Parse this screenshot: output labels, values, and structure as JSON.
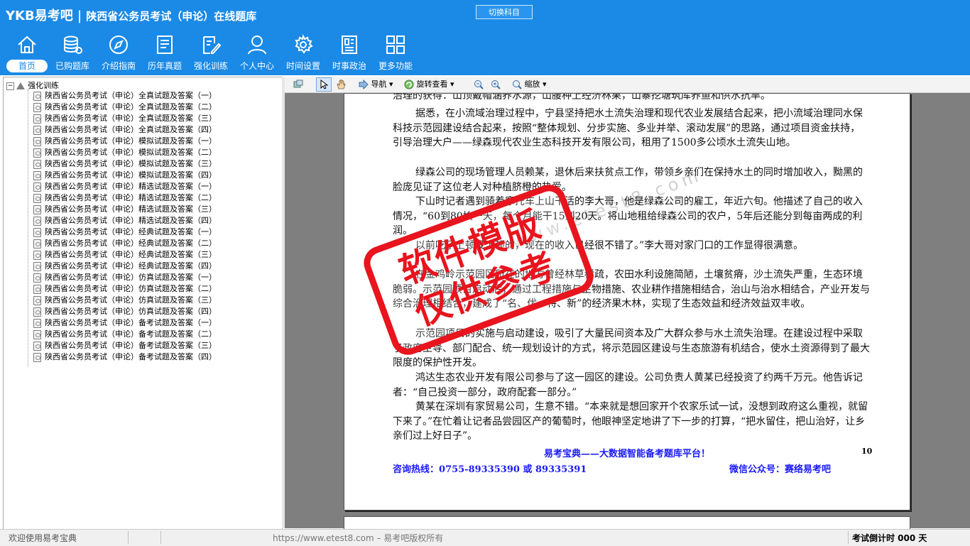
{
  "header": {
    "logo": "YKB易考吧",
    "title": "陕西省公务员考试（申论）在线题库",
    "switch_label": "切换科目"
  },
  "nav": [
    {
      "label": "首页",
      "icon": "home-icon"
    },
    {
      "label": "已购题库",
      "icon": "database-icon"
    },
    {
      "label": "介绍指南",
      "icon": "compass-icon"
    },
    {
      "label": "历年真题",
      "icon": "document-list-icon"
    },
    {
      "label": "强化训练",
      "icon": "edit-icon"
    },
    {
      "label": "个人中心",
      "icon": "user-icon"
    },
    {
      "label": "时间设置",
      "icon": "gear-icon"
    },
    {
      "label": "时事政治",
      "icon": "news-icon"
    },
    {
      "label": "更多功能",
      "icon": "grid-icon"
    }
  ],
  "tree": {
    "toggle": "−",
    "root": "强化训练",
    "items": [
      "陕西省公务员考试（申论）全真试题及答案（一）",
      "陕西省公务员考试（申论）全真试题及答案（二）",
      "陕西省公务员考试（申论）全真试题及答案（三）",
      "陕西省公务员考试（申论）全真试题及答案（四）",
      "陕西省公务员考试（申论）模拟试题及答案（一）",
      "陕西省公务员考试（申论）模拟试题及答案（二）",
      "陕西省公务员考试（申论）模拟试题及答案（三）",
      "陕西省公务员考试（申论）模拟试题及答案（四）",
      "陕西省公务员考试（申论）精选试题及答案（一）",
      "陕西省公务员考试（申论）精选试题及答案（二）",
      "陕西省公务员考试（申论）精选试题及答案（三）",
      "陕西省公务员考试（申论）精选试题及答案（四）",
      "陕西省公务员考试（申论）经典试题及答案（一）",
      "陕西省公务员考试（申论）经典试题及答案（二）",
      "陕西省公务员考试（申论）经典试题及答案（三）",
      "陕西省公务员考试（申论）经典试题及答案（四）",
      "陕西省公务员考试（申论）仿真试题及答案（一）",
      "陕西省公务员考试（申论）仿真试题及答案（二）",
      "陕西省公务员考试（申论）仿真试题及答案（三）",
      "陕西省公务员考试（申论）仿真试题及答案（四）",
      "陕西省公务员考试（申论）备考试题及答案（一）",
      "陕西省公务员考试（申论）备考试题及答案（二）",
      "陕西省公务员考试（申论）备考试题及答案（三）",
      "陕西省公务员考试（申论）备考试题及答案（四）"
    ]
  },
  "toolbar": {
    "nav_label": "导航",
    "rotate_label": "旋转查看",
    "zoom_label": "缩放"
  },
  "document": {
    "paragraphs": [
      {
        "text": "治理的获得：山顶戴帽涵养水源，山腰种上经济林果，山寨挖塘筑库养鱼和供水抗旱。",
        "indent": false
      },
      {
        "text": "据悉，在小流域治理过程中，宁县坚持把水土流失治理和现代农业发展结合起来，把小流域治理同水保科技示范园建设结合起来，按照“整体规划、分步实施、多业并举、滚动发展”的思路，通过项目资金扶持，引导治理大户——绿森现代农业生态科技开发有限公司，租用了1500多公顷水土流失山地。",
        "indent": true
      },
      {
        "text": "绿森公司的现场管理人员赖某，退休后来扶贫点工作，带领乡亲们在保持水土的同时增加收入，黝黑的脸庞见证了这位老人对种植脐橙的热爱。",
        "indent": true
      },
      {
        "text": "下山时记者遇到骑着摩托车上山干活的李大哥，他是绿森公司的雇工，年近六旬。他描述了自己的收入情况，“60到80块一天，每个月能干15到20天。将山地租给绿森公司的农户，5年后还能分到每亩两成的利润。",
        "indent": true
      },
      {
        "text": "以前吃了上顿没下顿的，现在的收入已经很不错了。”李大哥对家门口的工作显得很满意。",
        "indent": true
      },
      {
        "text": "在金鸡岭示范园区所在的地方曾经林草稀疏，农田水利设施简陋，土壤贫瘠，沙土流失严重，生态环境脆弱。示范园项目启动后，通过工程措施与生物措施、农业耕作措施相结合，治山与治水相结合，产业开发与综合治理相结合，建成了“名、优、特、新”的经济果木林，实现了生态效益和经济效益双丰收。",
        "indent": true
      },
      {
        "text": "示范园项目的实施与启动建设，吸引了大量民间资本及广大群众参与水土流失治理。在建设过程中采取了政府主导、部门配合、统一规划设计的方式，将示范园区建设与生态旅游有机结合，使水土资源得到了最大限度的保护性开发。",
        "indent": true
      },
      {
        "text": "鸿达生态农业开发有限公司参与了这一园区的建设。公司负责人黄某已经投资了约两千万元。他告诉记者：“自己投资一部分，政府配套一部分。”",
        "indent": true
      },
      {
        "text": "黄某在深圳有家贸易公司，生意不错。“本来就是想回家开个农家乐试一试，没想到政府这么重视，就留下来了。”在忙着让记者品尝园区产的葡萄时，他眼神坚定地讲了下一步的打算，“把水留住，把山治好，让乡亲们过上好日子”。",
        "indent": true
      }
    ],
    "slogan": "易考宝典——大数据智能备考题库平台！",
    "page_number": "10",
    "hotline": "咨询热线：0755-89335390 或 89335391",
    "wechat": "微信公众号：赛络易考吧",
    "watermark_url": "www.etest8.com"
  },
  "stamp": {
    "line1": "软件模版",
    "line2": "仅供参考"
  },
  "status": {
    "welcome": "欢迎使用易考宝典",
    "copyright": "https://www.etest8.com – 易考吧版权所有",
    "countdown": "考试倒计时 000 天"
  },
  "colors": {
    "header_bg": "#1a8ae6",
    "stamp": "#e8141e",
    "footer_text": "#1a1aff"
  }
}
